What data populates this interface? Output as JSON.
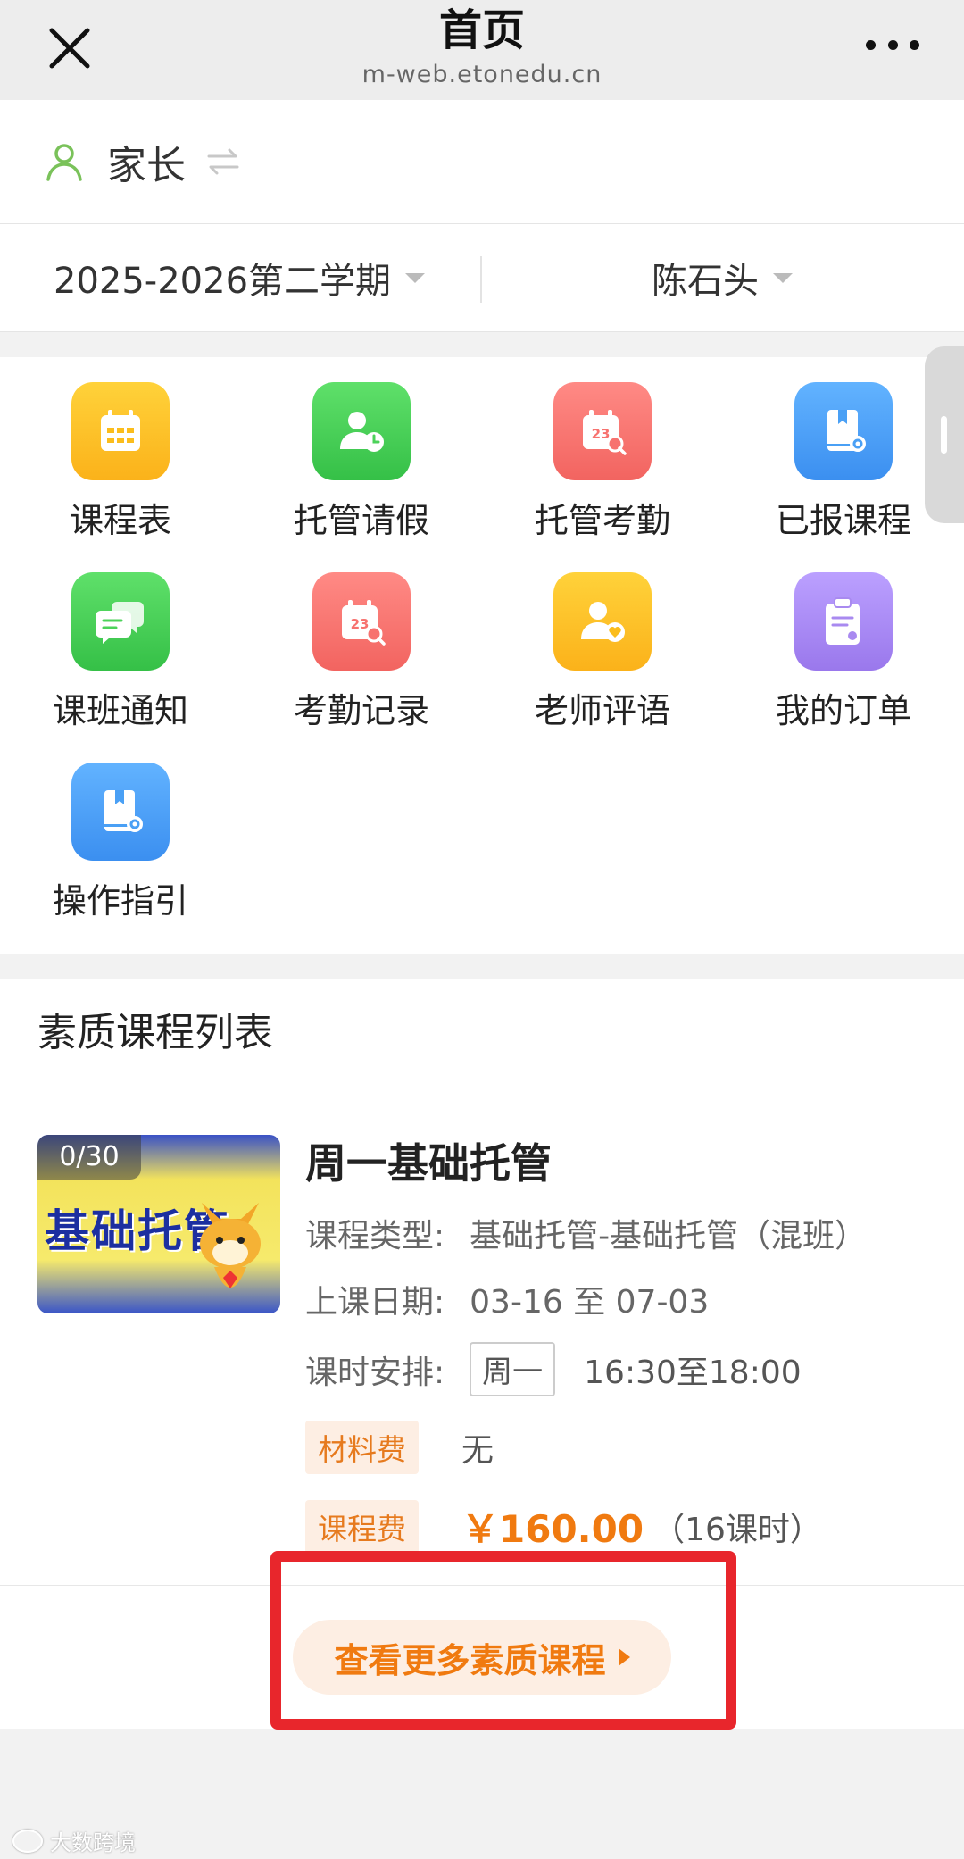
{
  "topbar": {
    "title": "首页",
    "url": "m-web.etonedu.cn"
  },
  "role": {
    "label": "家长"
  },
  "filters": {
    "term": "2025-2026第二学期",
    "student": "陈石头"
  },
  "menu": {
    "items": [
      {
        "label": "课程表",
        "icon": "calendar-icon",
        "color": "#fbbd1c"
      },
      {
        "label": "托管请假",
        "icon": "person-clock-icon",
        "color": "#4cd25a"
      },
      {
        "label": "托管考勤",
        "icon": "calendar-search-icon",
        "color": "#f7726f"
      },
      {
        "label": "已报课程",
        "icon": "book-gear-icon",
        "color": "#4aa0f5"
      },
      {
        "label": "课班通知",
        "icon": "chat-bubble-icon",
        "color": "#4cd25a"
      },
      {
        "label": "考勤记录",
        "icon": "calendar-search-icon",
        "color": "#f7726f"
      },
      {
        "label": "老师评语",
        "icon": "person-heart-icon",
        "color": "#fbbd1c"
      },
      {
        "label": "我的订单",
        "icon": "clipboard-icon",
        "color": "#a98af0"
      },
      {
        "label": "操作指引",
        "icon": "book-gear-icon",
        "color": "#4aa0f5"
      }
    ],
    "calendar_day": "23"
  },
  "course_list": {
    "title": "素质课程列表",
    "courses": [
      {
        "thumb_count": "0/30",
        "thumb_text": "基础托管",
        "name": "周一基础托管",
        "type_label": "课程类型:",
        "type_value": "基础托管-基础托管（混班）",
        "date_label": "上课日期:",
        "date_value": "03-16 至 07-03",
        "schedule_label": "课时安排:",
        "schedule_day": "周一",
        "schedule_time": "16:30至18:00",
        "material_label": "材料费",
        "material_value": "无",
        "fee_label": "课程费",
        "fee_value": "￥160.00",
        "fee_hours": "（16课时）"
      }
    ],
    "more_button": "查看更多素质课程"
  },
  "watermark": "大数跨境",
  "colors": {
    "accent_orange": "#f07a10",
    "highlight_red": "#e8262c",
    "role_green": "#7ac25a"
  }
}
